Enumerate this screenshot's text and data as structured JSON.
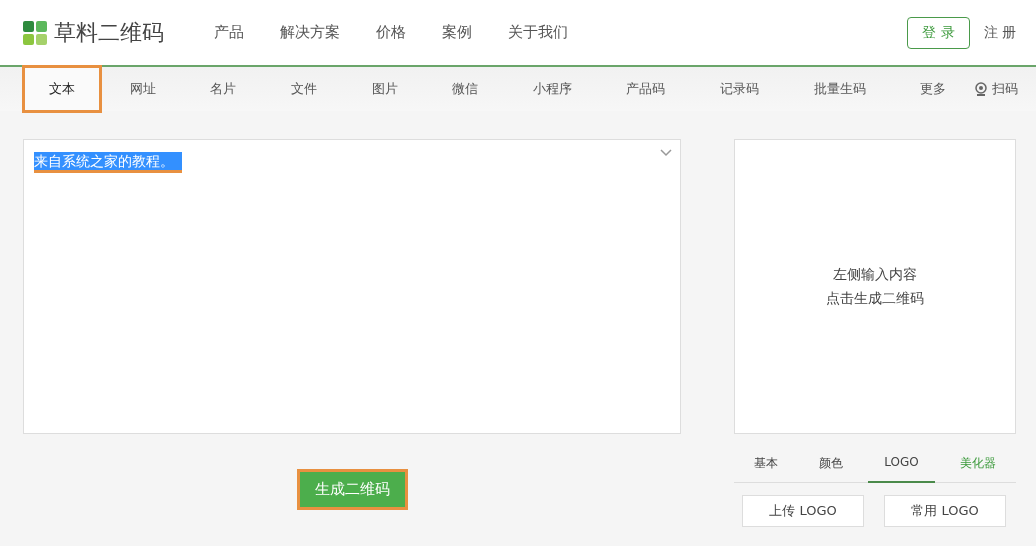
{
  "header": {
    "logo": "草料二维码",
    "nav": [
      "产品",
      "解决方案",
      "价格",
      "案例",
      "关于我们"
    ],
    "login": "登 录",
    "register": "注 册"
  },
  "tabs": [
    {
      "label": "文本",
      "selected": true,
      "annotated": true
    },
    {
      "label": "网址",
      "selected": false,
      "annotated": false
    },
    {
      "label": "名片",
      "selected": false,
      "annotated": false
    },
    {
      "label": "文件",
      "selected": false,
      "annotated": false
    },
    {
      "label": "图片",
      "selected": false,
      "annotated": false
    },
    {
      "label": "微信",
      "selected": false,
      "annotated": false
    },
    {
      "label": "小程序",
      "selected": false,
      "annotated": false
    },
    {
      "label": "产品码",
      "selected": false,
      "annotated": false
    },
    {
      "label": "记录码",
      "selected": false,
      "annotated": false
    },
    {
      "label": "批量生码",
      "selected": false,
      "annotated": false
    },
    {
      "label": "更多",
      "selected": false,
      "annotated": false
    }
  ],
  "scan": "扫码",
  "editor": {
    "value": "来自系统之家的教程。",
    "text_selected": true,
    "annotated": true
  },
  "generate_button": {
    "label": "生成二维码",
    "annotated": true
  },
  "preview": {
    "lines": [
      "左侧输入内容",
      "点击生成二维码"
    ]
  },
  "settings_tabs": [
    {
      "label": "基本",
      "selected": false,
      "kind": "tab"
    },
    {
      "label": "颜色",
      "selected": false,
      "kind": "tab"
    },
    {
      "label": "LOGO",
      "selected": true,
      "kind": "tab"
    },
    {
      "label": "美化器",
      "selected": false,
      "kind": "link"
    }
  ],
  "logo_buttons": [
    "上传 LOGO",
    "常用 LOGO"
  ]
}
